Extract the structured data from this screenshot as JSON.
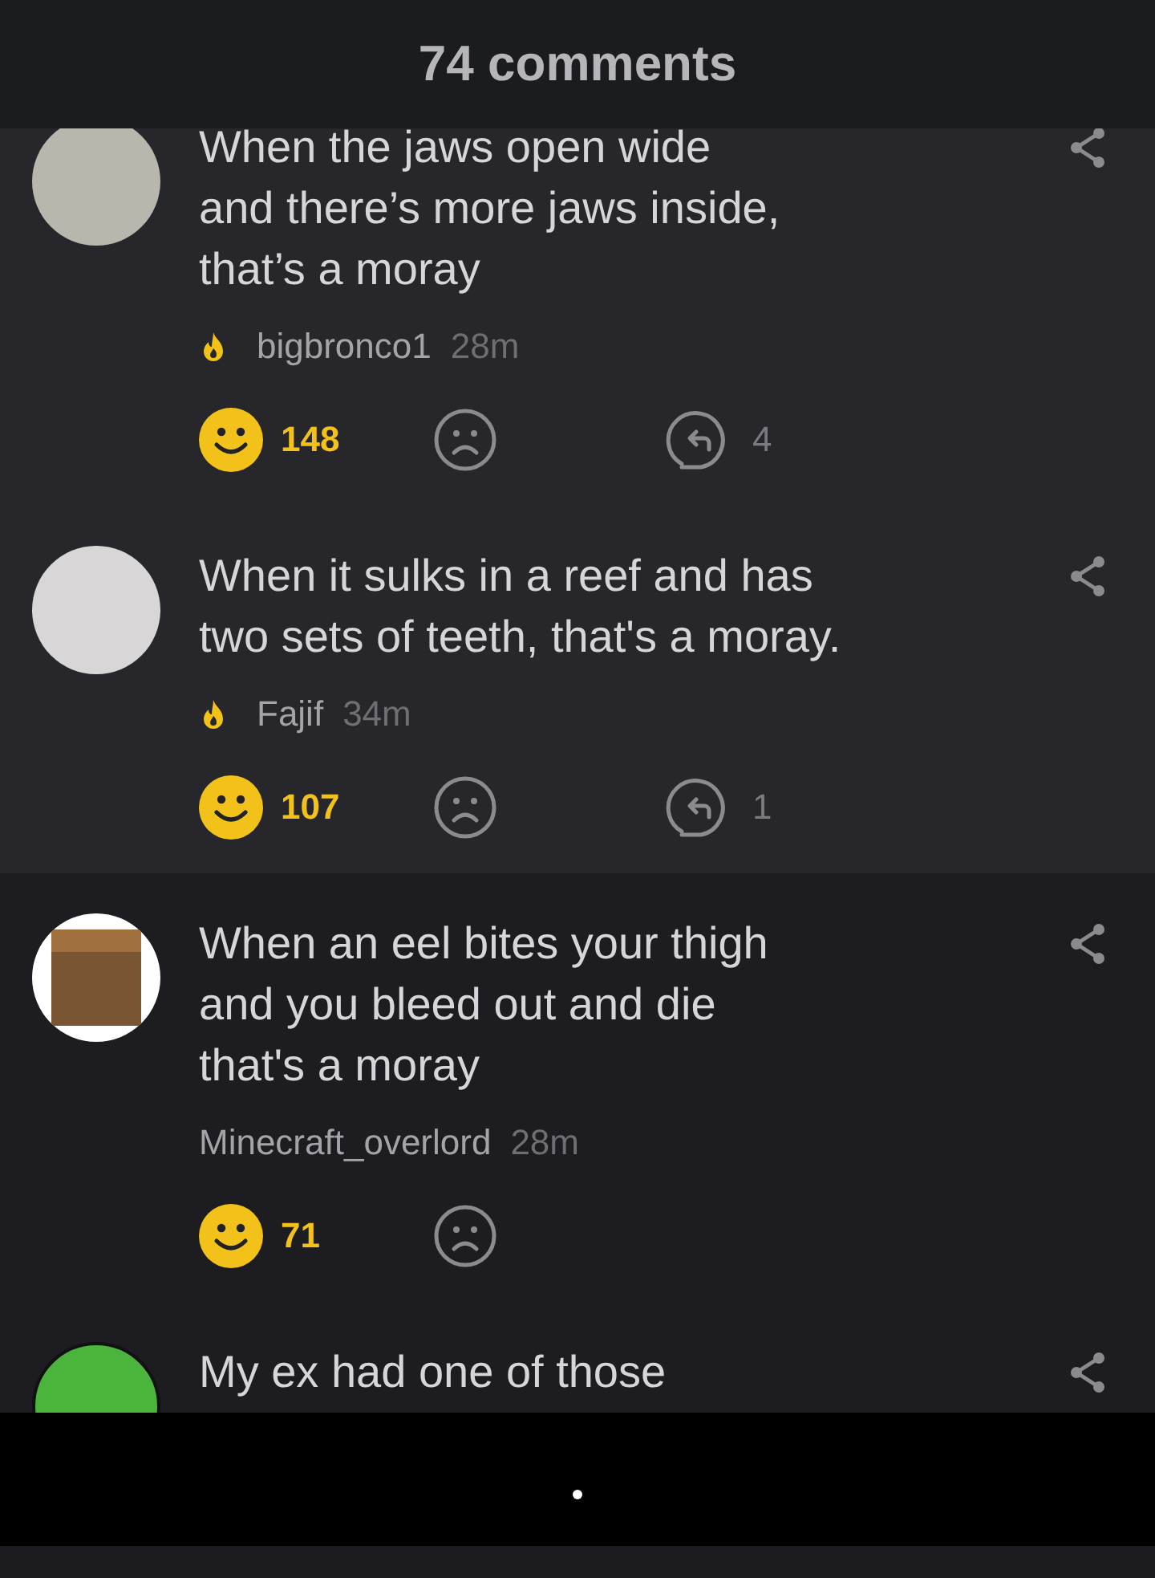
{
  "header": {
    "title": "74 comments"
  },
  "comments": [
    {
      "text": "When the jaws open wide\nand there’s more jaws inside,\nthat’s a moray",
      "avatar": {
        "kind": "photo"
      },
      "flame": true,
      "user": "bigbronco1",
      "time": "28m",
      "smiles": "148",
      "replies": "4",
      "highlighted": true
    },
    {
      "text": "When it sulks in a reef and has\ntwo sets of teeth, that's a moray.",
      "avatar": {
        "kind": "cartoon"
      },
      "flame": true,
      "user": "Fajif",
      "time": "34m",
      "smiles": "107",
      "replies": "1",
      "highlighted": true
    },
    {
      "text": "When an eel bites your thigh\nand you bleed out and die\nthat's a moray",
      "avatar": {
        "kind": "block"
      },
      "flame": false,
      "user": "Minecraft_overlord",
      "time": "28m",
      "smiles": "71",
      "highlighted": false
    },
    {
      "text": "My ex had one of those",
      "avatar": {
        "kind": "emblem"
      }
    }
  ]
}
